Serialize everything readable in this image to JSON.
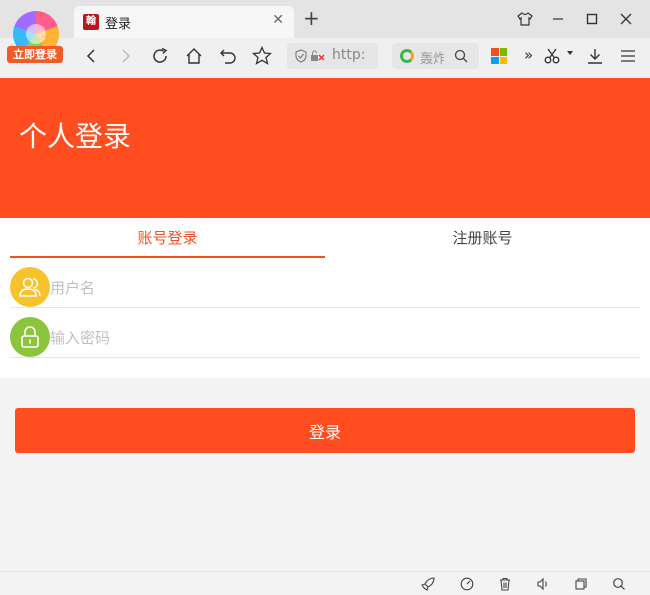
{
  "browser": {
    "tab": {
      "title": "登录",
      "favicon_text": "翰"
    },
    "account_badge": "立即登录",
    "address_text": "http:",
    "search_text": "轰炸",
    "more_label": "»"
  },
  "page": {
    "header_title": "个人登录",
    "tabs": [
      {
        "label": "账号登录",
        "active": true
      },
      {
        "label": "注册账号",
        "active": false
      }
    ],
    "username": {
      "placeholder": "用户名",
      "value": ""
    },
    "password": {
      "placeholder": "输入密码",
      "value": ""
    },
    "submit_label": "登录"
  },
  "colors": {
    "brand": "#ff4d1f",
    "tab_active": "#f25126",
    "user_icon_bg": "#f7c22b",
    "lock_icon_bg": "#8cc43e"
  },
  "icons": {
    "toolbar": [
      "back-icon",
      "forward-icon",
      "reload-icon",
      "home-icon",
      "undo-icon",
      "star-icon"
    ],
    "status": [
      "rocket-icon",
      "speed-icon",
      "trash-icon",
      "sound-icon",
      "window-icon",
      "search-icon"
    ]
  }
}
